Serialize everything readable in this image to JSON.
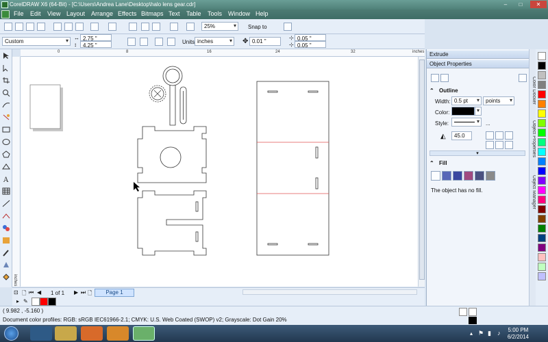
{
  "window": {
    "title": "CorelDRAW X6 (64-Bit) - [C:\\Users\\Andrea Lane\\Desktop\\halo lens gear.cdr]",
    "min": "–",
    "max": "□",
    "close": "✕"
  },
  "menu": [
    "File",
    "Edit",
    "View",
    "Layout",
    "Arrange",
    "Effects",
    "Bitmaps",
    "Text",
    "Table",
    "Tools",
    "Window",
    "Help"
  ],
  "toolbar": {
    "zoom": "25%",
    "snap_to": "Snap to"
  },
  "propbar": {
    "page_size": "Custom",
    "width": "2.75 \"",
    "height": "4.25 \"",
    "units_label": "Units:",
    "units": "inches",
    "nudge": "0.01 \"",
    "dup_x": "0.05 \"",
    "dup_y": "0.05 \""
  },
  "ruler": {
    "h_labels": [
      "0",
      "8",
      "16",
      "24",
      "32",
      "inches"
    ],
    "v_label": "inches"
  },
  "pagenav": {
    "counter": "1 of 1",
    "tab": "Page 1"
  },
  "status": {
    "coords": "( 9.982 , -5.160 )",
    "profiles": "Document color profiles: RGB: sRGB IEC61966-2.1; CMYK: U.S. Web Coated (SWOP) v2; Grayscale: Dot Gain 20%"
  },
  "docker": {
    "extrude": "Extrude",
    "object_properties": "Object Properties",
    "outline": {
      "title": "Outline",
      "width_label": "Width:",
      "width": "0.5 pt",
      "width_units": "points",
      "color_label": "Color:",
      "style_label": "Style:",
      "miter": "45.0",
      "ellipsis": "..."
    },
    "fill": {
      "title": "Fill",
      "message": "The object has no fill."
    },
    "side_tabs": [
      "Color Docker",
      "Object Properties",
      "Object Manager"
    ]
  },
  "taskbar": {
    "time": "5:00 PM",
    "date": "6/2/2014"
  },
  "colors": {
    "accent": "#3f6d66",
    "guide_red": "#e05050"
  },
  "palette": [
    "#ffffff",
    "#000000",
    "#c0c0c0",
    "#808080",
    "#ff0000",
    "#ff8000",
    "#ffff00",
    "#80ff00",
    "#00ff00",
    "#00ff80",
    "#00ffff",
    "#0080ff",
    "#0000ff",
    "#8000ff",
    "#ff00ff",
    "#ff0080",
    "#800000",
    "#804000",
    "#008000",
    "#004080",
    "#800080",
    "#ffc0c0",
    "#c0ffc0",
    "#c0c0ff"
  ]
}
